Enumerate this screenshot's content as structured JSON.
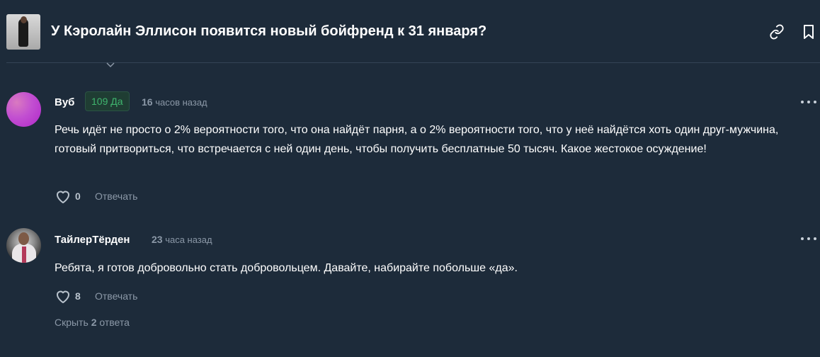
{
  "header": {
    "title": "У Кэролайн Эллисон появится новый бойфренд к 31 января?",
    "icons": [
      "link-icon",
      "bookmark-icon"
    ]
  },
  "comments": [
    {
      "username": "Вуб",
      "badge": "109 Да",
      "time_num": "16",
      "time_text": "часов назад",
      "text": "Речь идёт не просто о 2% вероятности того, что она найдёт парня, а о 2% вероятности того, что у неё найдётся хоть один друг-мужчина, готовый притвориться, что встречается с ней один день, чтобы получить бесплатные 50 тысяч. Какое жестокое осуждение!",
      "likes": "0",
      "reply_label": "Отвечать"
    },
    {
      "username": "ТайлерТёрден",
      "time_num": "23",
      "time_text": "часа назад",
      "text": "Ребята, я готов добровольно стать добровольцем. Давайте, набирайте побольше «да».",
      "likes": "8",
      "reply_label": "Отвечать"
    }
  ],
  "hide_replies": {
    "prefix": "Скрыть",
    "count": "2",
    "suffix": "ответа"
  },
  "colors": {
    "background": "#1d2b3a",
    "badge_green": "#3fb56e",
    "muted": "#8b98a7"
  }
}
